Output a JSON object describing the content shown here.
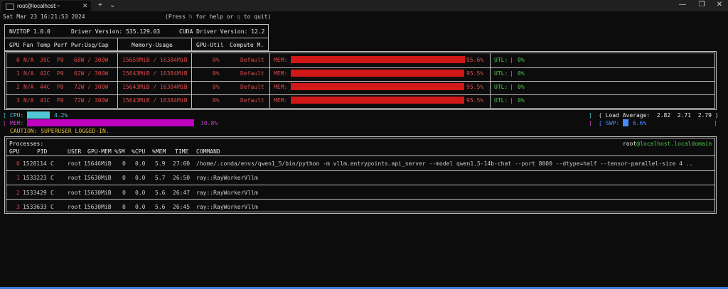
{
  "window": {
    "tab_title": "root@localhost:~",
    "tab_close": "✕",
    "new_tab": "+",
    "tab_menu": "⌄",
    "minimize": "—",
    "maximize": "❐",
    "close": "✕"
  },
  "header": {
    "datetime": "Sat Mar 23 16:21:53 2024",
    "help_prefix": "(Press ",
    "help_key": "h",
    "help_mid": " for help or ",
    "quit_key": "q",
    "help_suffix": " to quit)"
  },
  "summary": {
    "nvitop": "NVITOP 1.0.0",
    "driver": "Driver Version: 535.129.03",
    "cuda": "CUDA Driver Version: 12.2",
    "col_left": "GPU Fan Temp Perf Pwr:Usg/Cap",
    "col_mem": "Memory-Usage",
    "col_util": "GPU-Util",
    "col_compute": "Compute M."
  },
  "gpus": [
    {
      "id": "0",
      "fan": "N/A",
      "temp": "39C",
      "perf": "P0",
      "power": "68W / 300W",
      "memory": "15659MiB / 16384MiB",
      "util": "0%",
      "compute": "Default",
      "mem_label": "MEM:",
      "mem_pct": "95.6%",
      "mem_fraction": 0.956,
      "utl_label": "UTL:",
      "utl_pct": "0%"
    },
    {
      "id": "1",
      "fan": "N/A",
      "temp": "42C",
      "perf": "P0",
      "power": "62W / 300W",
      "memory": "15643MiB / 16384MiB",
      "util": "0%",
      "compute": "Default",
      "mem_label": "MEM:",
      "mem_pct": "95.5%",
      "mem_fraction": 0.955,
      "utl_label": "UTL:",
      "utl_pct": "0%"
    },
    {
      "id": "2",
      "fan": "N/A",
      "temp": "44C",
      "perf": "P0",
      "power": "72W / 300W",
      "memory": "15643MiB / 16384MiB",
      "util": "0%",
      "compute": "Default",
      "mem_label": "MEM:",
      "mem_pct": "95.5%",
      "mem_fraction": 0.955,
      "utl_label": "UTL:",
      "utl_pct": "0%"
    },
    {
      "id": "3",
      "fan": "N/A",
      "temp": "41C",
      "perf": "P0",
      "power": "72W / 300W",
      "memory": "15643MiB / 16384MiB",
      "util": "0%",
      "compute": "Default",
      "mem_label": "MEM:",
      "mem_pct": "95.5%",
      "mem_fraction": 0.955,
      "utl_label": "UTL:",
      "utl_pct": "0%"
    }
  ],
  "host": {
    "cpu_label": "CPU:",
    "cpu_pct": "4.2%",
    "cpu_fraction": 0.042,
    "mem_label": "MEM:",
    "mem_pct": "30.8%",
    "mem_fraction": 0.308,
    "load_label": "( Load Average:",
    "load_1": "2.82",
    "load_5": "2.71",
    "load_15": "2.79",
    "load_close": ")",
    "swp_label": "SWP:",
    "swp_pct": "6.6%",
    "swp_fraction": 0.066,
    "caution": "CAUTION: SUPERUSER LOGGED-IN."
  },
  "processes": {
    "title": "Processes:",
    "user_host_user": "root",
    "user_host_at": "@",
    "user_host_host": "localhost.localdomain",
    "headers": {
      "gpu": "GPU",
      "pid": "PID",
      "user": "USER",
      "gpumem": "GPU-MEM",
      "sm": "%SM",
      "cpu": "%CPU",
      "mem": "%MEM",
      "time": "TIME",
      "command": "COMMAND"
    },
    "rows": [
      {
        "gpu": "0",
        "pid": "1528114",
        "type": "C",
        "user": "root",
        "gpumem": "15646MiB",
        "sm": "0",
        "cpu": "0.0",
        "mem": "5.9",
        "time": "27:00",
        "command": "/home/.conda/envs/qwen1_5/bin/python -m vllm.entrypoints.api_server --model qwen1.5-14b-chat --port 8000 --dtype=half --tensor-parallel-size 4 .."
      },
      {
        "gpu": "1",
        "pid": "1533223",
        "type": "C",
        "user": "root",
        "gpumem": "15630MiB",
        "sm": "0",
        "cpu": "0.0",
        "mem": "5.7",
        "time": "26:50",
        "command": "ray::RayWorkerVllm"
      },
      {
        "gpu": "2",
        "pid": "1533429",
        "type": "C",
        "user": "root",
        "gpumem": "15630MiB",
        "sm": "0",
        "cpu": "0.0",
        "mem": "5.6",
        "time": "26:47",
        "command": "ray::RayWorkerVllm"
      },
      {
        "gpu": "3",
        "pid": "1533633",
        "type": "C",
        "user": "root",
        "gpumem": "15630MiB",
        "sm": "0",
        "cpu": "0.0",
        "mem": "5.6",
        "time": "26:45",
        "command": "ray::RayWorkerVllm"
      }
    ]
  },
  "colors": {
    "background": "#0c0c0c",
    "gpu_text": "#e04848",
    "mem_bar": "#d01818",
    "cpu_bar": "#4fc7d4",
    "host_mem_bar": "#c000c0",
    "swp_bar": "#4a8cff",
    "caution": "#e0c040",
    "host_name": "#4ec94e"
  }
}
